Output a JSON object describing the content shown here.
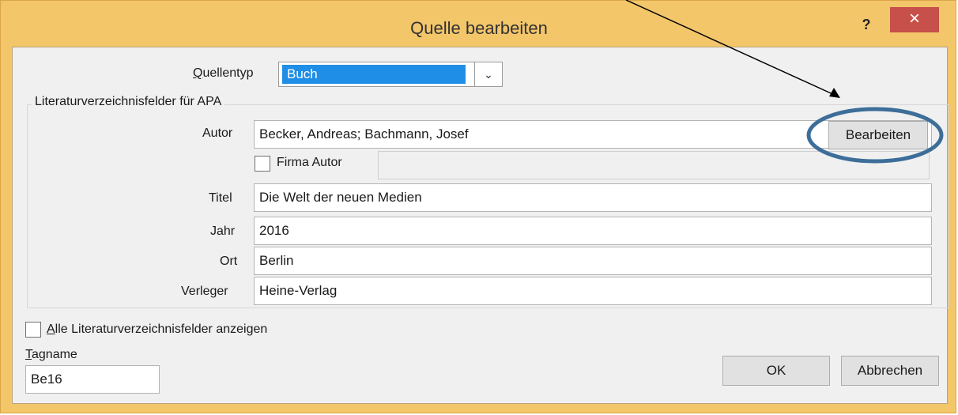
{
  "title": "Quelle bearbeiten",
  "help_label": "?",
  "close_label": "×",
  "quellentyp": {
    "label_underline": "Q",
    "label_rest": "uellentyp",
    "value": "Buch",
    "arrow": "⌄"
  },
  "group_legend": "Literaturverzeichnisfelder für APA",
  "autor": {
    "label": "Autor",
    "value": "Becker, Andreas; Bachmann, Josef",
    "edit_button": "Bearbeiten"
  },
  "firma_autor": {
    "label": "Firma Autor",
    "value": ""
  },
  "titel": {
    "label": "Titel",
    "value": "Die Welt der neuen Medien"
  },
  "jahr": {
    "label": "Jahr",
    "value": "2016"
  },
  "ort": {
    "label": "Ort",
    "value": "Berlin"
  },
  "verleger": {
    "label": "Verleger",
    "value": "Heine-Verlag"
  },
  "alle_felder": {
    "label_underline": "A",
    "label_rest": "lle Literaturverzeichnisfelder anzeigen"
  },
  "tagname": {
    "label_underline": "T",
    "label_rest": "agname",
    "value": "Be16"
  },
  "ok_label": "OK",
  "cancel_label": "Abbrechen",
  "annotation_color": "#3d6e99"
}
